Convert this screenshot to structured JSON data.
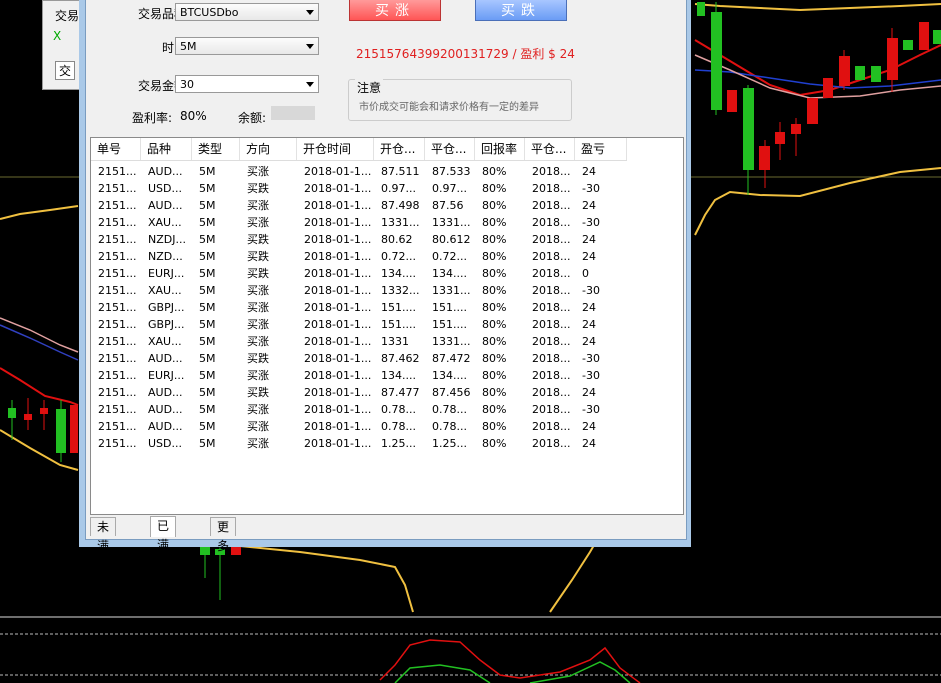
{
  "background": {
    "panel_text_1": "交易",
    "panel_text_2": "X",
    "panel_text_3": "交"
  },
  "form": {
    "symbol_label": "交易品种:",
    "symbol_value": "BTCUSDbo",
    "time_label": "时间:",
    "time_value": "5M",
    "amount_label": "交易金额:",
    "amount_value": "30",
    "rate_label": "盈利率:",
    "rate_value": "80%",
    "balance_label": "余额:"
  },
  "buttons": {
    "buy_label": "买涨",
    "sell_label": "买跌"
  },
  "profit_line": "21515764399200131729 / 盈利 $ 24",
  "notice": {
    "title": "注意",
    "body": "市价成交可能会和请求价格有一定的差异"
  },
  "table": {
    "headers": [
      "单号",
      "品种",
      "类型",
      "方向",
      "开仓时间",
      "开仓...",
      "平仓...",
      "回报率",
      "平仓...",
      "盈亏"
    ],
    "rows": [
      [
        "2151...",
        "AUD...",
        "5M",
        "买涨",
        "2018-01-1...",
        "87.511",
        "87.533",
        "80%",
        "2018...",
        "24"
      ],
      [
        "2151...",
        "USD...",
        "5M",
        "买跌",
        "2018-01-1...",
        "0.97...",
        "0.97...",
        "80%",
        "2018...",
        "-30"
      ],
      [
        "2151...",
        "AUD...",
        "5M",
        "买涨",
        "2018-01-1...",
        "87.498",
        "87.56",
        "80%",
        "2018...",
        "24"
      ],
      [
        "2151...",
        "XAU...",
        "5M",
        "买涨",
        "2018-01-1...",
        "1331...",
        "1331...",
        "80%",
        "2018...",
        "-30"
      ],
      [
        "2151...",
        "NZDJ...",
        "5M",
        "买跌",
        "2018-01-1...",
        "80.62",
        "80.612",
        "80%",
        "2018...",
        "24"
      ],
      [
        "2151...",
        "NZD...",
        "5M",
        "买跌",
        "2018-01-1...",
        "0.72...",
        "0.72...",
        "80%",
        "2018...",
        "24"
      ],
      [
        "2151...",
        "EURJ...",
        "5M",
        "买跌",
        "2018-01-1...",
        "134....",
        "134....",
        "80%",
        "2018...",
        "0"
      ],
      [
        "2151...",
        "XAU...",
        "5M",
        "买涨",
        "2018-01-1...",
        "1332...",
        "1331...",
        "80%",
        "2018...",
        "-30"
      ],
      [
        "2151...",
        "GBPJ...",
        "5M",
        "买涨",
        "2018-01-1...",
        "151....",
        "151....",
        "80%",
        "2018...",
        "24"
      ],
      [
        "2151...",
        "GBPJ...",
        "5M",
        "买涨",
        "2018-01-1...",
        "151....",
        "151....",
        "80%",
        "2018...",
        "24"
      ],
      [
        "2151...",
        "XAU...",
        "5M",
        "买涨",
        "2018-01-1...",
        "1331",
        "1331...",
        "80%",
        "2018...",
        "24"
      ],
      [
        "2151...",
        "AUD...",
        "5M",
        "买跌",
        "2018-01-1...",
        "87.462",
        "87.472",
        "80%",
        "2018...",
        "-30"
      ],
      [
        "2151...",
        "EURJ...",
        "5M",
        "买涨",
        "2018-01-1...",
        "134....",
        "134....",
        "80%",
        "2018...",
        "-30"
      ],
      [
        "2151...",
        "AUD...",
        "5M",
        "买跌",
        "2018-01-1...",
        "87.477",
        "87.456",
        "80%",
        "2018...",
        "24"
      ],
      [
        "2151...",
        "AUD...",
        "5M",
        "买涨",
        "2018-01-1...",
        "0.78...",
        "0.78...",
        "80%",
        "2018...",
        "-30"
      ],
      [
        "2151...",
        "AUD...",
        "5M",
        "买涨",
        "2018-01-1...",
        "0.78...",
        "0.78...",
        "80%",
        "2018...",
        "24"
      ],
      [
        "2151...",
        "USD...",
        "5M",
        "买涨",
        "2018-01-1...",
        "1.25...",
        "1.25...",
        "80%",
        "2018...",
        "24"
      ]
    ]
  },
  "tabs": [
    "未满期",
    "已满期",
    "更多"
  ],
  "active_tab": "已满期",
  "colors": {
    "profit_text": "#e02020",
    "buy_button": "#ff6060",
    "sell_button": "#6a9cf5",
    "candle_up": "#22c022",
    "candle_down": "#e01010",
    "band_line": "#f0c040"
  }
}
